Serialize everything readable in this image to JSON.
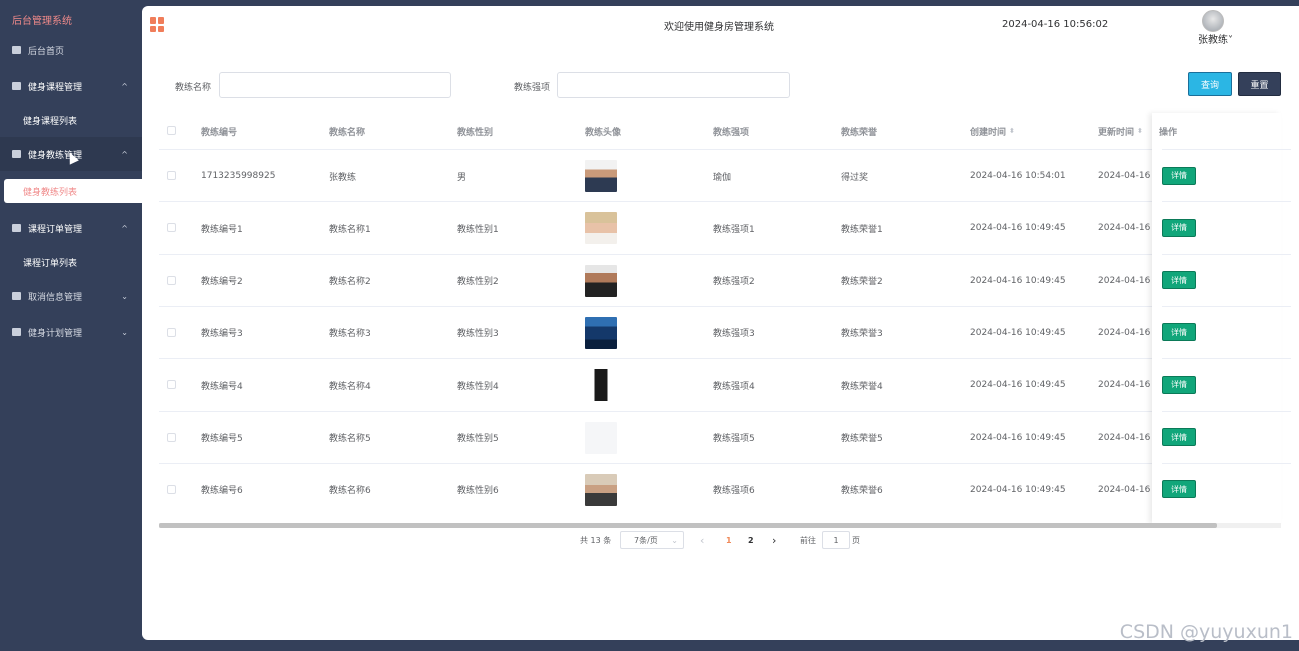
{
  "sidebar": {
    "brand": "后台管理系统",
    "items": [
      {
        "label": "后台首页"
      },
      {
        "label": "健身课程管理",
        "arrow": "^"
      },
      {
        "label": "健身课程列表"
      },
      {
        "label": "健身教练管理",
        "arrow": "^"
      },
      {
        "label": "健身教练列表"
      },
      {
        "label": "课程订单管理",
        "arrow": "^"
      },
      {
        "label": "课程订单列表"
      },
      {
        "label": "取消信息管理",
        "arrow": "⌄"
      },
      {
        "label": "健身计划管理",
        "arrow": "⌄"
      }
    ]
  },
  "header": {
    "welcome": "欢迎使用健身房管理系统",
    "datetime": "2024-04-16 10:56:02",
    "user": "张教练˅"
  },
  "search": {
    "name_label": "教练名称",
    "name_value": "",
    "skill_label": "教练强项",
    "skill_value": "",
    "query_label": "查询",
    "reset_label": "重置"
  },
  "table": {
    "columns": [
      "教练编号",
      "教练名称",
      "教练性别",
      "教练头像",
      "教练强项",
      "教练荣誉",
      "创建时间",
      "更新时间",
      "操作"
    ],
    "sort_icon": "⬍",
    "detail_label": "详情",
    "rows": [
      {
        "id": "1713235998925",
        "name": "张教练",
        "gender": "男",
        "skill": "瑜伽",
        "honor": "得过奖",
        "created": "2024-04-16 10:54:01",
        "updated": "2024-04-16 10",
        "photo": "man-suit"
      },
      {
        "id": "教练编号1",
        "name": "教练名称1",
        "gender": "教练性别1",
        "skill": "教练强项1",
        "honor": "教练荣誉1",
        "created": "2024-04-16 10:49:45",
        "updated": "2024-04-16 10",
        "photo": "woman-blonde"
      },
      {
        "id": "教练编号2",
        "name": "教练名称2",
        "gender": "教练性别2",
        "skill": "教练强项2",
        "honor": "教练荣誉2",
        "created": "2024-04-16 10:49:45",
        "updated": "2024-04-16 10",
        "photo": "man-gym"
      },
      {
        "id": "教练编号3",
        "name": "教练名称3",
        "gender": "教练性别3",
        "skill": "教练强项3",
        "honor": "教练荣誉3",
        "created": "2024-04-16 10:49:45",
        "updated": "2024-04-16 10",
        "photo": "man-blue"
      },
      {
        "id": "教练编号4",
        "name": "教练名称4",
        "gender": "教练性别4",
        "skill": "教练强项4",
        "honor": "教练荣誉4",
        "created": "2024-04-16 10:49:45",
        "updated": "2024-04-16 10",
        "photo": "woman-black"
      },
      {
        "id": "教练编号5",
        "name": "教练名称5",
        "gender": "教练性别5",
        "skill": "教练强项5",
        "honor": "教练荣誉5",
        "created": "2024-04-16 10:49:45",
        "updated": "2024-04-16 10",
        "photo": "blank"
      },
      {
        "id": "教练编号6",
        "name": "教练名称6",
        "gender": "教练性别6",
        "skill": "教练强项6",
        "honor": "教练荣誉6",
        "created": "2024-04-16 10:49:45",
        "updated": "2024-04-16 10",
        "photo": "woman-sport"
      }
    ]
  },
  "pagination": {
    "total": "共 13 条",
    "page_size": "7条/页",
    "prev": "‹",
    "pages": [
      "1",
      "2"
    ],
    "next": "›",
    "goto_label": "前往",
    "goto_value": "1",
    "page_unit": "页"
  },
  "colors": {
    "sidebar": "#34405a",
    "accent": "#f08a8a",
    "query": "#2bb6e4",
    "detail": "#11a67a"
  },
  "watermark": "CSDN @yuyuxun1"
}
